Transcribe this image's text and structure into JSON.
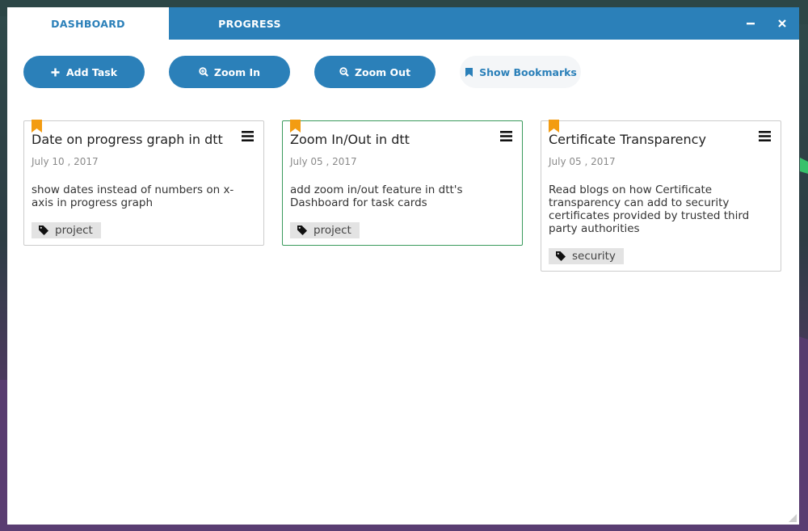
{
  "colors": {
    "accent": "#2b80b9",
    "bookmark": "#f39c12",
    "card_border_active": "#3a9a5c",
    "tag_bg": "#e3e3e3"
  },
  "tabs": [
    {
      "label": "DASHBOARD",
      "active": true
    },
    {
      "label": "PROGRESS",
      "active": false
    }
  ],
  "window_controls": {
    "minimize_icon": "minus-icon",
    "close_icon": "close-icon"
  },
  "toolbar": {
    "add_task": {
      "label": "Add Task",
      "icon": "plus-icon"
    },
    "zoom_in": {
      "label": "Zoom In",
      "icon": "zoom-in-icon"
    },
    "zoom_out": {
      "label": "Zoom Out",
      "icon": "zoom-out-icon"
    },
    "show_bookmarks": {
      "label": "Show Bookmarks",
      "icon": "bookmark-icon"
    }
  },
  "cards": [
    {
      "title": "Date on progress graph in dtt",
      "date": "July 10 , 2017",
      "description": "show dates instead of numbers on x-axis in progress graph",
      "tag": "project",
      "bookmarked": true
    },
    {
      "title": "Zoom In/Out in dtt",
      "date": "July 05 , 2017",
      "description": "add zoom in/out feature in dtt's Dashboard for task cards",
      "tag": "project",
      "bookmarked": true,
      "selected": true
    },
    {
      "title": "Certificate Transparency",
      "date": "July 05 , 2017",
      "description": "Read blogs on how Certificate transparency can add to security certificates provided by trusted third party authorities",
      "tag": "security",
      "bookmarked": true
    }
  ]
}
